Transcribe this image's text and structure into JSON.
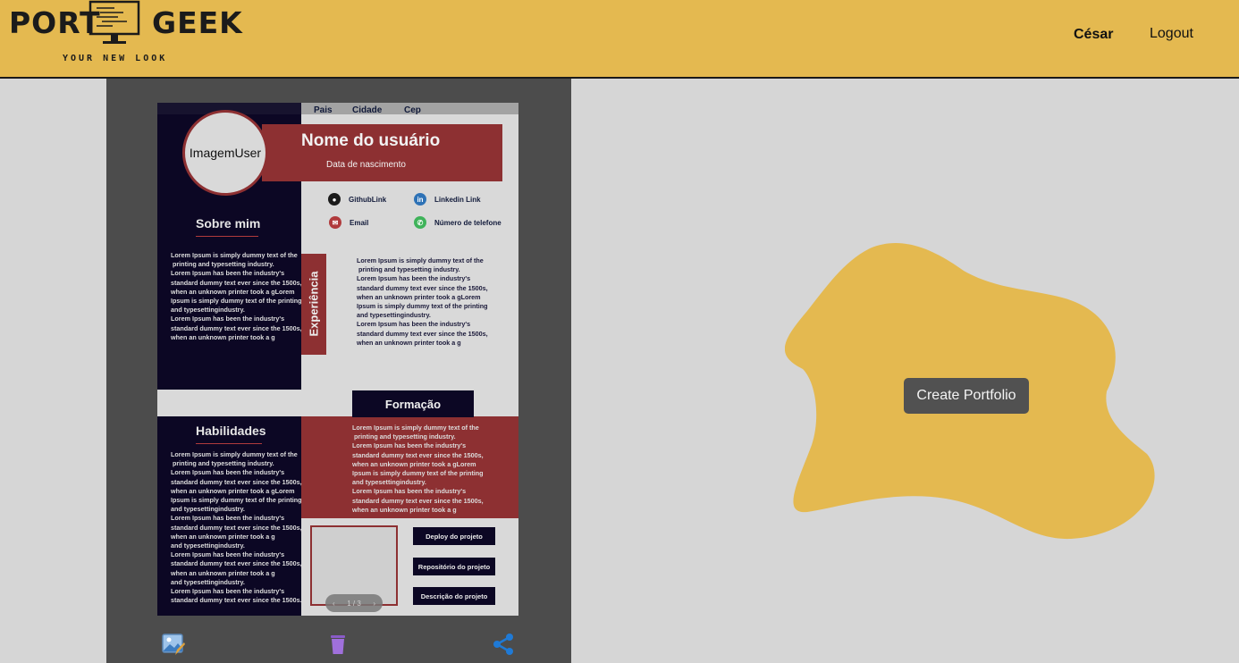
{
  "header": {
    "logo_left": "PORT",
    "logo_right": "GEEK",
    "tagline": "YOUR NEW LOOK",
    "user_name": "César",
    "logout_label": "Logout",
    "bg_color": "#e4b950"
  },
  "preview": {
    "location": {
      "pais": "Pais",
      "cidade": "Cidade",
      "cep": "Cep"
    },
    "avatar_label": "ImagemUser",
    "name": "Nome do usuário",
    "birth": "Data de nascimento",
    "contacts": {
      "github": "GithubLink",
      "linkedin": "Linkedin Link",
      "email": "Email",
      "phone": "Número de telefone"
    },
    "about_title": "Sobre mim",
    "about_text": "Lorem Ipsum is simply dummy text of the\n printing and typesetting industry.\nLorem Ipsum has been the industry's\nstandard dummy text ever since the 1500s,\nwhen an unknown printer took a gLorem\nIpsum is simply dummy text of the printing\nand typesettingindustry.\nLorem Ipsum has been the industry's\nstandard dummy text ever since the 1500s,\nwhen an unknown printer took a g",
    "experience_label": "Experiência",
    "experience_text": "Lorem Ipsum is simply dummy text of the\n printing and typesetting industry.\nLorem Ipsum has been the industry's\nstandard dummy text ever since the 1500s,\nwhen an unknown printer took a gLorem\nIpsum is simply dummy text of the printing\nand typesettingindustry.\nLorem Ipsum has been the industry's\nstandard dummy text ever since the 1500s,\nwhen an unknown printer took a g",
    "education_label": "Formação",
    "education_text": "Lorem Ipsum is simply dummy text of the\n printing and typesetting industry.\nLorem Ipsum has been the industry's\nstandard dummy text ever since the 1500s,\nwhen an unknown printer took a gLorem\nIpsum is simply dummy text of the printing\nand typesettingindustry.\nLorem Ipsum has been the industry's\nstandard dummy text ever since the 1500s,\nwhen an unknown printer took a g",
    "skills_title": "Habilidades",
    "skills_text": "Lorem Ipsum is simply dummy text of the\n printing and typesetting industry.\nLorem Ipsum has been the industry's\nstandard dummy text ever since the 1500s,\nwhen an unknown printer took a gLorem\nIpsum is simply dummy text of the printing\nand typesettingindustry.\nLorem Ipsum has been the industry's\nstandard dummy text ever since the 1500s,\nwhen an unknown printer took a g\nand typesettingindustry.\nLorem Ipsum has been the industry's\nstandard dummy text ever since the 1500s,\nwhen an unknown printer took a g\nand typesettingindustry.\nLorem Ipsum has been the industry's\nstandard dummy text ever since the 1500s.",
    "project_buttons": {
      "deploy": "Deploy do projeto",
      "repo": "Repositório do projeto",
      "desc": "Descrição do projeto"
    },
    "pager": "1 / 3"
  },
  "actions": {
    "image_icon": "image-edit-icon",
    "delete_icon": "trash-icon",
    "share_icon": "share-icon"
  },
  "main": {
    "create_label": "Create Portfolio"
  }
}
